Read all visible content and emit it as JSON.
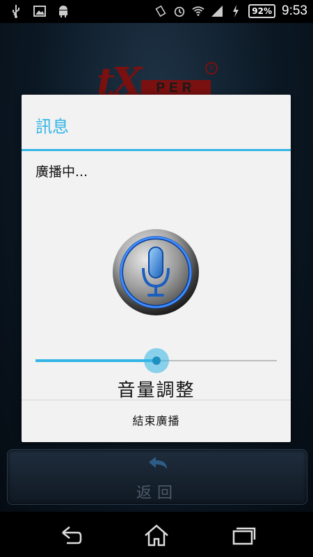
{
  "status_bar": {
    "left_icons": [
      "usb-icon",
      "image-icon",
      "android-icon"
    ],
    "right_icons": [
      "vibrate-icon",
      "alarm-icon",
      "wifi-icon",
      "signal-icon",
      "charging-icon"
    ],
    "battery": "92%",
    "time": "9:53"
  },
  "logo": {
    "main": "tX",
    "sub": "PER",
    "reg": "R"
  },
  "dialog": {
    "title": "訊息",
    "message": "廣播中...",
    "icon": "microphone-icon",
    "volume": {
      "value": 0.5,
      "label": "音量調整"
    },
    "stop_button": "結束廣播"
  },
  "back_button": {
    "label": "返回",
    "icon": "back-arrow-icon"
  },
  "nav_bar": {
    "buttons": [
      "back-icon",
      "home-icon",
      "recent-apps-icon"
    ]
  },
  "colors": {
    "accent": "#33b5e5",
    "brand": "#7a1010"
  }
}
